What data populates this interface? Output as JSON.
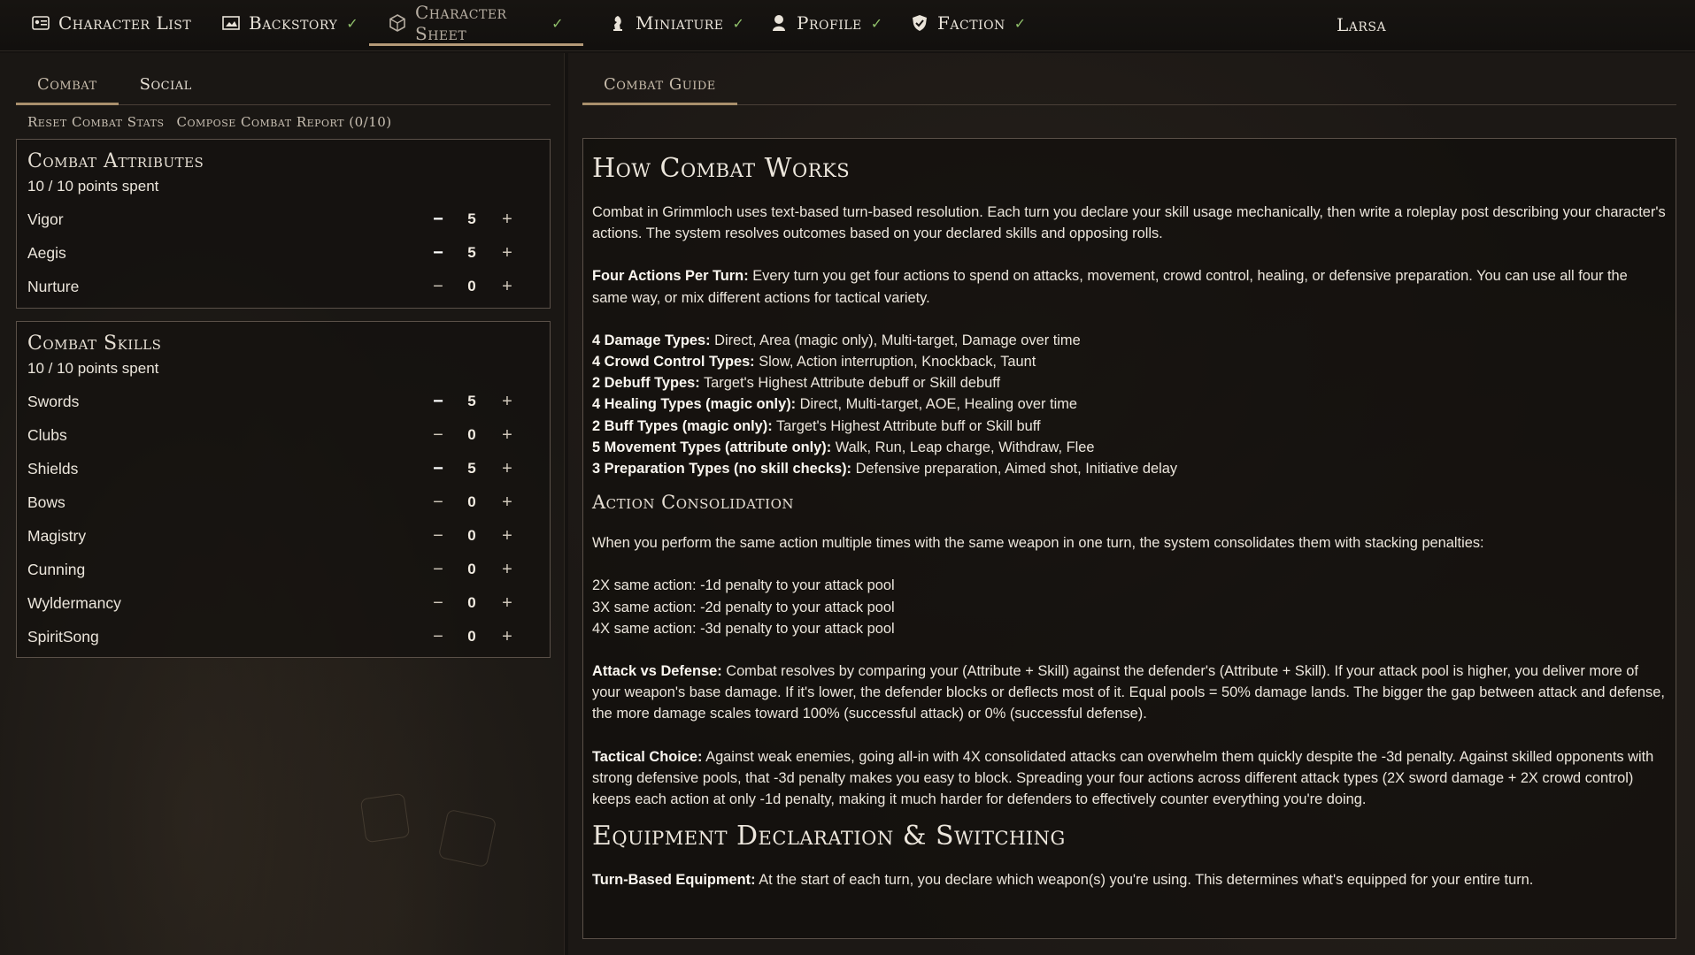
{
  "nav": {
    "items": [
      {
        "label": "Character List",
        "check": ""
      },
      {
        "label": "Backstory",
        "check": "✓"
      },
      {
        "label": "Character Sheet",
        "check": "✓"
      },
      {
        "label": "Miniature",
        "check": "✓"
      },
      {
        "label": "Profile",
        "check": "✓"
      },
      {
        "label": "Faction",
        "check": "✓"
      }
    ],
    "active": "Character Sheet",
    "character_name": "Larsa"
  },
  "left": {
    "tabs": [
      "Combat",
      "Social"
    ],
    "active_tab": "Combat",
    "actions": [
      "Reset Combat Stats",
      "Compose Combat Report (0/10)"
    ],
    "attributes": {
      "title": "Combat Attributes",
      "spent": "10 / 10 points spent",
      "rows": [
        {
          "name": "Vigor",
          "value": "5"
        },
        {
          "name": "Aegis",
          "value": "5"
        },
        {
          "name": "Nurture",
          "value": "0"
        }
      ]
    },
    "skills": {
      "title": "Combat Skills",
      "spent": "10 / 10 points spent",
      "rows": [
        {
          "name": "Swords",
          "value": "5"
        },
        {
          "name": "Clubs",
          "value": "0"
        },
        {
          "name": "Shields",
          "value": "5"
        },
        {
          "name": "Bows",
          "value": "0"
        },
        {
          "name": "Magistry",
          "value": "0"
        },
        {
          "name": "Cunning",
          "value": "0"
        },
        {
          "name": "Wyldermancy",
          "value": "0"
        },
        {
          "name": "SpiritSong",
          "value": "0"
        }
      ]
    },
    "minus_symbol": "−",
    "plus_symbol": "+"
  },
  "right": {
    "tab": "Combat Guide",
    "title": "How Combat Works",
    "intro": "Combat in Grimmloch uses text-based turn-based resolution. Each turn you declare your skill usage mechanically, then write a roleplay post describing your character's actions. The system resolves outcomes based on your declared skills and opposing rolls.",
    "four_actions": {
      "label": "Four Actions Per Turn:",
      "text": " Every turn you get four actions to spend on attacks, movement, crowd control, healing, or defensive preparation. You can use all four the same way, or mix different actions for tactical variety."
    },
    "types": [
      {
        "label": "4 Damage Types:",
        "text": " Direct, Area (magic only), Multi-target, Damage over time"
      },
      {
        "label": "4 Crowd Control Types:",
        "text": " Slow, Action interruption, Knockback, Taunt"
      },
      {
        "label": "2 Debuff Types:",
        "text": " Target's Highest Attribute debuff or Skill debuff"
      },
      {
        "label": "4 Healing Types (magic only):",
        "text": " Direct, Multi-target, AOE, Healing over time"
      },
      {
        "label": "2 Buff Types (magic only):",
        "text": " Target's Highest Attribute buff or Skill buff"
      },
      {
        "label": "5 Movement Types (attribute only):",
        "text": " Walk, Run, Leap charge, Withdraw, Flee"
      },
      {
        "label": "3 Preparation Types (no skill checks):",
        "text": " Defensive preparation, Aimed shot, Initiative delay"
      }
    ],
    "consolidation": {
      "title": "Action Consolidation",
      "text": "When you perform the same action multiple times with the same weapon in one turn, the system consolidates them with stacking penalties:",
      "lines": [
        "2X same action: -1d penalty to your attack pool",
        "3X same action: -2d penalty to your attack pool",
        "4X same action: -3d penalty to your attack pool"
      ]
    },
    "attack_defense": {
      "label": "Attack vs Defense:",
      "text": " Combat resolves by comparing your (Attribute + Skill) against the defender's (Attribute + Skill). If your attack pool is higher, you deliver more of your weapon's base damage. If it's lower, the defender blocks or deflects most of it. Equal pools = 50% damage lands. The bigger the gap between attack and defense, the more damage scales toward 100% (successful attack) or 0% (successful defense)."
    },
    "tactical": {
      "label": "Tactical Choice:",
      "text": " Against weak enemies, going all-in with 4X consolidated attacks can overwhelm them quickly despite the -3d penalty. Against skilled opponents with strong defensive pools, that -3d penalty makes you easy to block. Spreading your four actions across different attack types (2X sword damage + 2X crowd control) keeps each action at only -1d penalty, making it much harder for defenders to effectively counter everything you're doing."
    },
    "equipment": {
      "title": "Equipment Declaration & Switching",
      "label": "Turn-Based Equipment:",
      "text": " At the start of each turn, you declare which weapon(s) you're using. This determines what's equipped for your entire turn."
    }
  }
}
